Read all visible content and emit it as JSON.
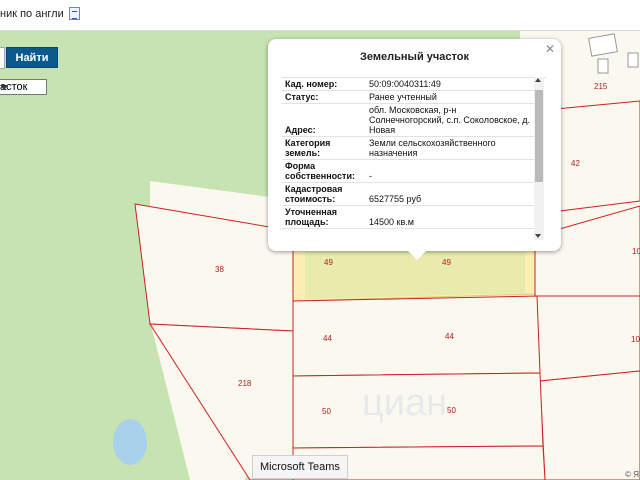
{
  "topbar": {
    "partial_text": "ник по англи",
    "doc_icon": "document-icon"
  },
  "search": {
    "button_label": "Найти",
    "select_value": "асток"
  },
  "map": {
    "parcel_labels": [
      "215",
      "42",
      "10",
      "38",
      "49",
      "49",
      "44",
      "44",
      "10",
      "218",
      "50",
      "50"
    ],
    "watermark": "циан",
    "copyright": "© Я"
  },
  "popup": {
    "title": "Земельный участок",
    "close_icon": "close-icon",
    "rows": [
      {
        "key": "Кад. номер:",
        "value": "50:09:0040311:49"
      },
      {
        "key": "Статус:",
        "value": "Ранее учтенный"
      },
      {
        "key": "Адрес:",
        "value": "обл. Московская, р-н Солнечногорский, с.п. Соколовское, д. Новая"
      },
      {
        "key": "Категория земель:",
        "value": "Земли сельскохозяйственного назначения"
      },
      {
        "key": "Форма собственности:",
        "value": "-"
      },
      {
        "key": "Кадастровая стоимость:",
        "value": "6527755 руб"
      },
      {
        "key": "Уточненная площадь:",
        "value": "14500 кв.м"
      }
    ]
  },
  "tooltip": "Microsoft Teams",
  "colors": {
    "forest": "#c7e3b1",
    "parcel_fill": "#fbf8f0",
    "parcel_border": "#cc2222",
    "selected_parcel": "#fbefb4",
    "button": "#0b5a8c"
  }
}
